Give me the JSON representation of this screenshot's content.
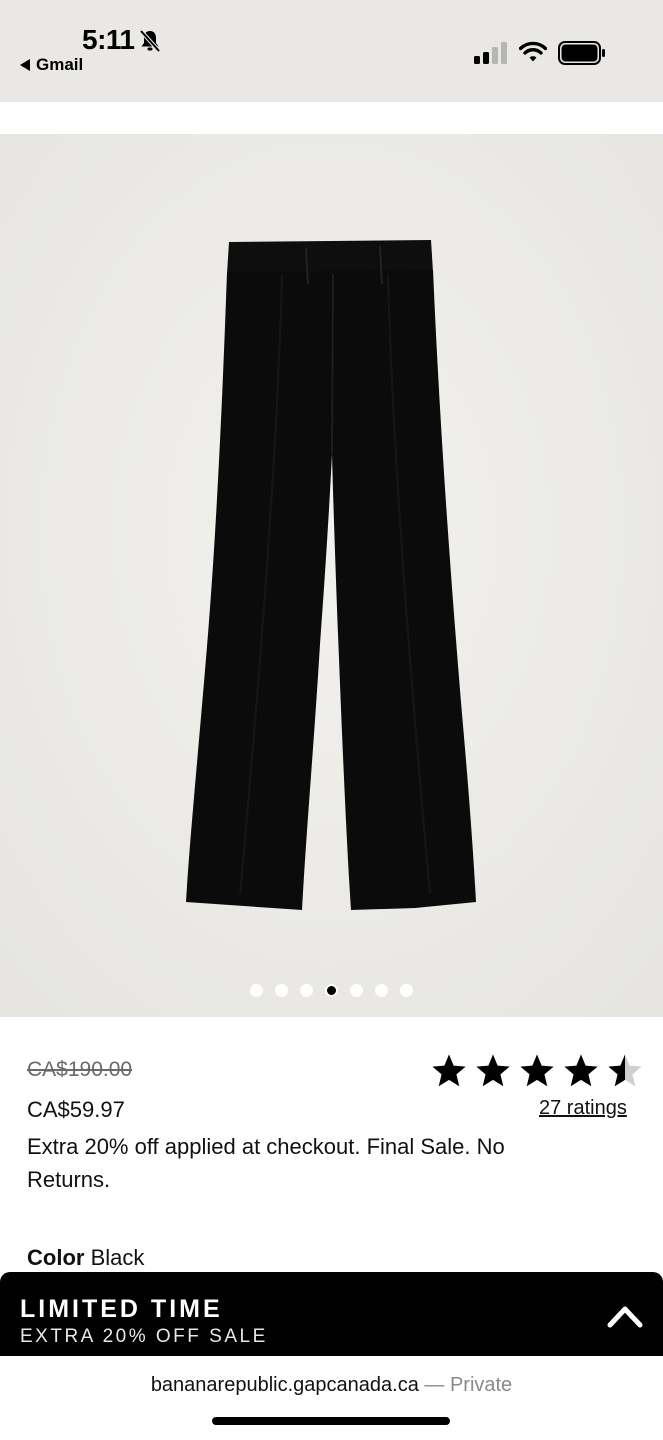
{
  "status_bar": {
    "time": "5:11",
    "back_label": "Gmail"
  },
  "gallery": {
    "image_name": "black-flare-pants",
    "dot_count": 7,
    "active_index": 3
  },
  "product": {
    "original_price": "CA$190.00",
    "sale_price": "CA$59.97",
    "promo_text": "Extra 20% off applied at checkout. Final Sale. No Returns.",
    "rating": 4.5,
    "ratings_link": "27 ratings",
    "color_label": "Color",
    "color_value": "Black"
  },
  "banner": {
    "title": "LIMITED TIME",
    "subtitle": "EXTRA 20% OFF SALE",
    "icon": "chevron-up-icon"
  },
  "url_bar": {
    "domain": "bananarepublic.gapcanada.ca",
    "separator": " — ",
    "mode": "Private"
  },
  "colors": {
    "status_bg": "#e9e8e5",
    "image_bg": "#ebeae7",
    "banner_bg": "#000000",
    "private_text": "#8a8a8a"
  }
}
